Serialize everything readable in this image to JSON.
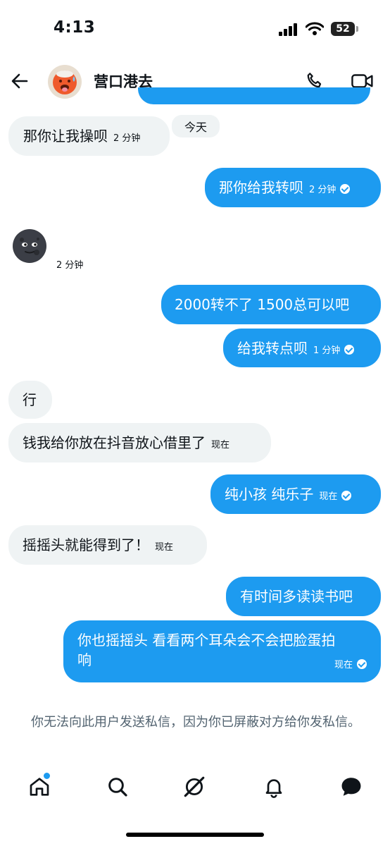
{
  "status_bar": {
    "time": "4:13",
    "battery": "52"
  },
  "header": {
    "name": "营口港去"
  },
  "day_divider": "今天",
  "messages": [
    {
      "dir": "in",
      "text": "那你让我操呗",
      "time": "2 分钟"
    },
    {
      "dir": "out",
      "text": "那你给我转呗",
      "time": "2 分钟"
    },
    {
      "dir": "in",
      "time": "2 分钟"
    },
    {
      "dir": "out",
      "text": "2000转不了 1500总可以吧"
    },
    {
      "dir": "out",
      "text": "给我转点呗",
      "time": "1 分钟"
    },
    {
      "dir": "in",
      "text": "行"
    },
    {
      "dir": "in",
      "text": "钱我给你放在抖音放心借里了",
      "time": "现在"
    },
    {
      "dir": "out",
      "text": "纯小孩 纯乐子",
      "time": "现在"
    },
    {
      "dir": "in",
      "text": "摇摇头就能得到了！",
      "time": "现在"
    },
    {
      "dir": "out",
      "text": "有时间多读读书吧"
    },
    {
      "dir": "out",
      "text_line1": "你也摇摇头 看看两个耳朵会不会把脸蛋拍",
      "text_line2": "响",
      "time": "现在"
    }
  ],
  "notice": "你无法向此用户发送私信，因为你已屏蔽对方给你发私信。",
  "icons": [
    "back-arrow-icon",
    "phone-icon",
    "video-icon",
    "home-icon",
    "search-icon",
    "grok-icon",
    "bell-icon",
    "messages-icon"
  ]
}
